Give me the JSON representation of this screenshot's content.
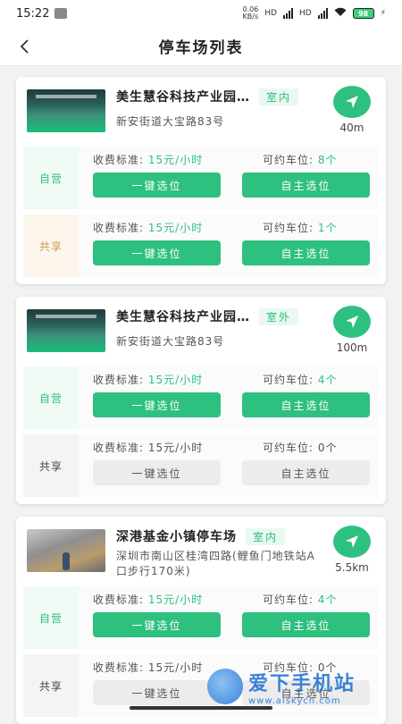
{
  "status": {
    "time": "15:22",
    "net_speed": "0.06",
    "net_unit": "KB/s",
    "signal_1": "HD",
    "signal_2": "HD",
    "battery": "98"
  },
  "header": {
    "title": "停车场列表"
  },
  "labels": {
    "fee": "收费标准:",
    "spots": "可约车位:",
    "one_click": "一键选位",
    "self_select": "自主选位"
  },
  "lots": [
    {
      "name": "美生慧谷科技产业园…",
      "tag": "室内",
      "address": "新安街道大宝路83号",
      "distance": "40m",
      "sections": [
        {
          "label": "自营",
          "fee": "15元/小时",
          "spots": "8个",
          "active": true
        },
        {
          "label": "共享",
          "fee": "15元/小时",
          "spots": "1个",
          "active": true
        }
      ]
    },
    {
      "name": "美生慧谷科技产业园…",
      "tag": "室外",
      "address": "新安街道大宝路83号",
      "distance": "100m",
      "sections": [
        {
          "label": "自营",
          "fee": "15元/小时",
          "spots": "4个",
          "active": true
        },
        {
          "label": "共享",
          "fee": "15元/小时",
          "spots": "0个",
          "active": false
        }
      ]
    },
    {
      "name": "深港基金小镇停车场",
      "tag": "室内",
      "address": "深圳市南山区桂湾四路(鲤鱼门地铁站A口步行170米)",
      "distance": "5.5km",
      "sections": [
        {
          "label": "自营",
          "fee": "15元/小时",
          "spots": "4个",
          "active": true
        },
        {
          "label": "共享",
          "fee": "15元/小时",
          "spots": "0个",
          "active": false
        }
      ]
    }
  ],
  "watermark": {
    "title": "爱下手机站",
    "url": "www.aiskycn.com"
  },
  "colors": {
    "accent": "#2ec07e",
    "share_label": "#c89a52",
    "disabled": "#ececec"
  }
}
